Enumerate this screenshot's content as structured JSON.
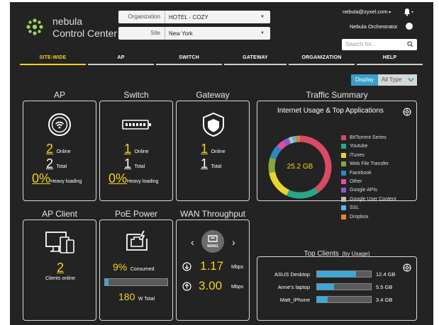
{
  "brand": {
    "line1": "nebula",
    "line2": "Control Center"
  },
  "header": {
    "org_label": "Organization",
    "org_value": "HOTEL - COZY",
    "site_label": "Site",
    "site_value": "New York",
    "user": "nebula@zyxel.com",
    "orchestrator": "Nebula Orchestrator",
    "search_placeholder": "Search for..."
  },
  "tabs": [
    {
      "label": "SITE-WIDE",
      "active": true
    },
    {
      "label": "AP"
    },
    {
      "label": "SWITCH"
    },
    {
      "label": "GATEWAY"
    },
    {
      "label": "ORGANIZATION"
    },
    {
      "label": "HELP"
    }
  ],
  "display": {
    "label": "Display",
    "type": "All Type"
  },
  "ap": {
    "title": "AP",
    "online": "2",
    "online_label": "Online",
    "total": "2",
    "total_label": "Total",
    "heavy": "0%",
    "heavy_label": "Heavy loading"
  },
  "switch": {
    "title": "Switch",
    "online": "1",
    "online_label": "Online",
    "total": "1",
    "total_label": "Total",
    "heavy": "0%",
    "heavy_label": "Heavy loading"
  },
  "gateway": {
    "title": "Gateway",
    "online": "1",
    "online_label": "Online",
    "total": "1",
    "total_label": "Total"
  },
  "traffic": {
    "title": "Traffic Summary",
    "subtitle": "Internet Usage & Top Applications",
    "center": "25.2 GB",
    "apps": [
      {
        "name": "BitTorrent Series",
        "color": "#d94a64",
        "share": 0.4
      },
      {
        "name": "Youtube",
        "color": "#2aa58a",
        "share": 0.17
      },
      {
        "name": "iTunes",
        "color": "#e8d431",
        "share": 0.15
      },
      {
        "name": "Web File Transfer",
        "color": "#86a83a",
        "share": 0.08
      },
      {
        "name": "Facebook",
        "color": "#2b87c4",
        "share": 0.07
      },
      {
        "name": "Other",
        "color": "#e64c9e",
        "share": 0.04
      },
      {
        "name": "Google APIs",
        "color": "#8a5cc9",
        "share": 0.03
      },
      {
        "name": "Google User Content",
        "color": "#bdbdbd",
        "share": 0.02
      },
      {
        "name": "SSL",
        "color": "#54b9e3",
        "share": 0.02
      },
      {
        "name": "Dropbox",
        "color": "#e8822e",
        "share": 0.02
      }
    ]
  },
  "ap_client": {
    "title": "AP Client",
    "count": "2",
    "label": "Clients online"
  },
  "poe": {
    "title": "PoE Power",
    "consumed": "9%",
    "consumed_label": "Consumed",
    "fill": 0.06,
    "total": "180",
    "total_label": "W Total"
  },
  "wan": {
    "title": "WAN Throughput",
    "port": "WAN1",
    "down": "1.17",
    "up": "3.00",
    "unit": "Mbps"
  },
  "top_clients": {
    "title": "Top Clients",
    "subtitle": "(by Usage)",
    "rows": [
      {
        "name": "ASUS Desktop",
        "value": "12.4 GB",
        "fill": 0.48
      },
      {
        "name": "Anne's laptop",
        "value": "5.5 GB",
        "fill": 0.21
      },
      {
        "name": "Matt_iPhone",
        "value": "3.4 GB",
        "fill": 0.13
      }
    ]
  }
}
